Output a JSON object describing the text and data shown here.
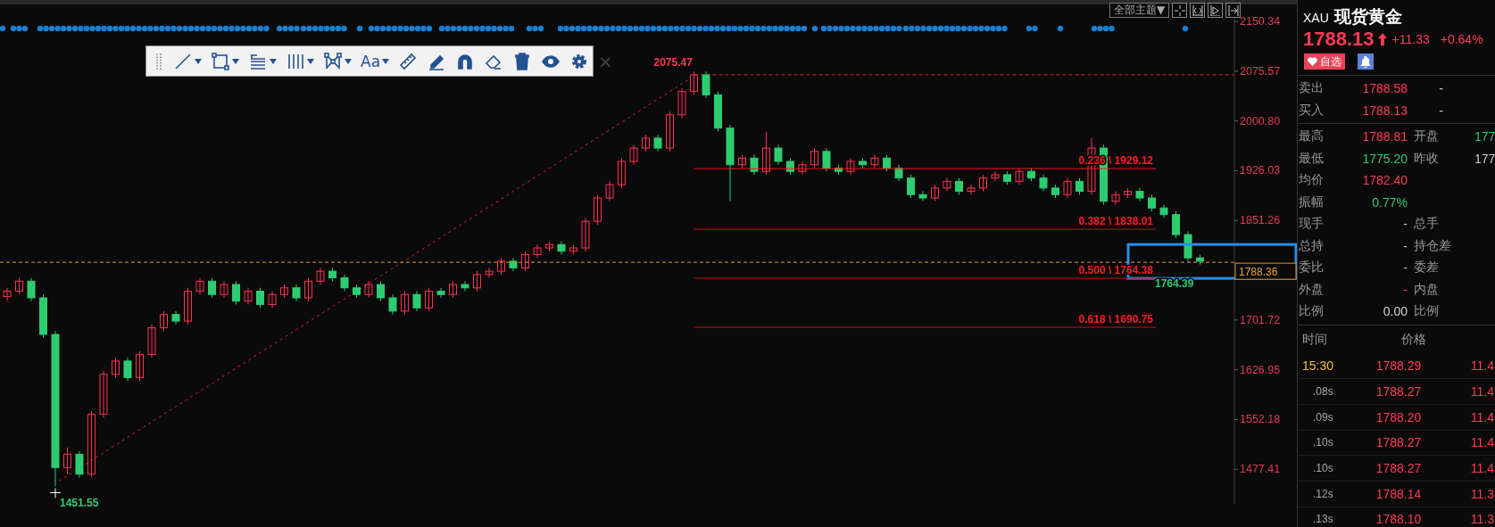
{
  "toolbar": [
    {
      "kind": "grip"
    },
    {
      "kind": "line",
      "dropdown": true
    },
    {
      "kind": "rectangle",
      "dropdown": true
    },
    {
      "kind": "gann",
      "dropdown": true
    },
    {
      "kind": "cycle",
      "dropdown": true
    },
    {
      "kind": "pattern",
      "dropdown": true
    },
    {
      "kind": "text",
      "label": "Aa",
      "dropdown": true
    },
    {
      "kind": "ruler",
      "dropdown": false
    },
    {
      "kind": "pencil",
      "dropdown": false
    },
    {
      "kind": "magnet",
      "dropdown": false
    },
    {
      "kind": "eraser",
      "dropdown": false
    },
    {
      "kind": "trash",
      "dropdown": false
    },
    {
      "kind": "eye",
      "dropdown": false
    },
    {
      "kind": "gear",
      "dropdown": false
    },
    {
      "kind": "close",
      "label": "×",
      "dropdown": false
    }
  ],
  "theme_menu": {
    "label": "全部主题▼"
  },
  "chart": {
    "chart_data": {
      "type": "candlestick",
      "ohlc": [
        [
          1737,
          1750,
          1730,
          1745
        ],
        [
          1745,
          1765,
          1740,
          1760
        ],
        [
          1760,
          1765,
          1730,
          1735
        ],
        [
          1735,
          1740,
          1675,
          1680
        ],
        [
          1680,
          1685,
          1451.55,
          1480
        ],
        [
          1480,
          1510,
          1470,
          1500
        ],
        [
          1500,
          1505,
          1465,
          1470
        ],
        [
          1470,
          1565,
          1465,
          1560
        ],
        [
          1560,
          1625,
          1555,
          1620
        ],
        [
          1620,
          1645,
          1615,
          1640
        ],
        [
          1640,
          1645,
          1610,
          1615
        ],
        [
          1615,
          1655,
          1610,
          1650
        ],
        [
          1650,
          1695,
          1645,
          1690
        ],
        [
          1690,
          1715,
          1685,
          1710
        ],
        [
          1710,
          1715,
          1695,
          1700
        ],
        [
          1700,
          1750,
          1695,
          1745
        ],
        [
          1745,
          1765,
          1740,
          1760
        ],
        [
          1760,
          1765,
          1735,
          1740
        ],
        [
          1740,
          1760,
          1735,
          1755
        ],
        [
          1755,
          1760,
          1725,
          1730
        ],
        [
          1730,
          1750,
          1725,
          1745
        ],
        [
          1745,
          1750,
          1720,
          1725
        ],
        [
          1725,
          1745,
          1720,
          1740
        ],
        [
          1740,
          1755,
          1735,
          1750
        ],
        [
          1750,
          1755,
          1730,
          1735
        ],
        [
          1735,
          1765,
          1730,
          1760
        ],
        [
          1760,
          1780,
          1755,
          1775
        ],
        [
          1775,
          1780,
          1760,
          1765
        ],
        [
          1765,
          1770,
          1745,
          1750
        ],
        [
          1750,
          1755,
          1735,
          1740
        ],
        [
          1740,
          1760,
          1735,
          1755
        ],
        [
          1755,
          1760,
          1730,
          1735
        ],
        [
          1735,
          1740,
          1710,
          1715
        ],
        [
          1715,
          1745,
          1710,
          1740
        ],
        [
          1740,
          1745,
          1715,
          1720
        ],
        [
          1720,
          1750,
          1715,
          1745
        ],
        [
          1745,
          1750,
          1735,
          1740
        ],
        [
          1740,
          1760,
          1735,
          1755
        ],
        [
          1755,
          1760,
          1745,
          1750
        ],
        [
          1750,
          1775,
          1745,
          1770
        ],
        [
          1770,
          1780,
          1765,
          1775
        ],
        [
          1775,
          1795,
          1770,
          1790
        ],
        [
          1790,
          1795,
          1775,
          1780
        ],
        [
          1780,
          1805,
          1775,
          1800
        ],
        [
          1800,
          1815,
          1795,
          1810
        ],
        [
          1810,
          1820,
          1805,
          1815
        ],
        [
          1815,
          1820,
          1800,
          1805
        ],
        [
          1805,
          1815,
          1800,
          1810
        ],
        [
          1810,
          1855,
          1805,
          1850
        ],
        [
          1850,
          1890,
          1845,
          1885
        ],
        [
          1885,
          1910,
          1880,
          1905
        ],
        [
          1905,
          1945,
          1900,
          1940
        ],
        [
          1940,
          1965,
          1935,
          1960
        ],
        [
          1960,
          1980,
          1955,
          1975
        ],
        [
          1975,
          1980,
          1955,
          1960
        ],
        [
          1960,
          2015,
          1955,
          2010
        ],
        [
          2010,
          2050,
          2005,
          2045
        ],
        [
          2045,
          2075.47,
          2040,
          2070
        ],
        [
          2070,
          2075,
          2035,
          2040
        ],
        [
          2040,
          2045,
          1985,
          1990
        ],
        [
          1990,
          1995,
          1880,
          1935
        ],
        [
          1935,
          1950,
          1930,
          1945
        ],
        [
          1945,
          1950,
          1920,
          1925
        ],
        [
          1925,
          1985,
          1920,
          1960
        ],
        [
          1960,
          1965,
          1935,
          1940
        ],
        [
          1940,
          1945,
          1920,
          1925
        ],
        [
          1925,
          1940,
          1920,
          1935
        ],
        [
          1935,
          1960,
          1930,
          1955
        ],
        [
          1955,
          1960,
          1925,
          1930
        ],
        [
          1930,
          1935,
          1920,
          1925
        ],
        [
          1925,
          1945,
          1920,
          1940
        ],
        [
          1940,
          1945,
          1930,
          1935
        ],
        [
          1935,
          1950,
          1930,
          1945
        ],
        [
          1945,
          1950,
          1925,
          1930
        ],
        [
          1930,
          1935,
          1910,
          1915
        ],
        [
          1915,
          1920,
          1885,
          1890
        ],
        [
          1890,
          1895,
          1880,
          1885
        ],
        [
          1885,
          1905,
          1880,
          1900
        ],
        [
          1900,
          1915,
          1895,
          1910
        ],
        [
          1910,
          1915,
          1890,
          1895
        ],
        [
          1895,
          1905,
          1890,
          1900
        ],
        [
          1900,
          1920,
          1895,
          1915
        ],
        [
          1915,
          1925,
          1910,
          1920
        ],
        [
          1920,
          1925,
          1905,
          1910
        ],
        [
          1910,
          1930,
          1905,
          1925
        ],
        [
          1925,
          1930,
          1910,
          1915
        ],
        [
          1915,
          1920,
          1895,
          1900
        ],
        [
          1900,
          1905,
          1885,
          1890
        ],
        [
          1890,
          1915,
          1885,
          1910
        ],
        [
          1910,
          1915,
          1890,
          1895
        ],
        [
          1895,
          1975,
          1890,
          1960
        ],
        [
          1960,
          1965,
          1875,
          1880
        ],
        [
          1880,
          1895,
          1875,
          1890
        ],
        [
          1890,
          1900,
          1885,
          1895
        ],
        [
          1895,
          1900,
          1880,
          1885
        ],
        [
          1885,
          1890,
          1865,
          1870
        ],
        [
          1870,
          1875,
          1855,
          1860
        ],
        [
          1860,
          1865,
          1825,
          1830
        ],
        [
          1830,
          1835,
          1790,
          1795
        ],
        [
          1795,
          1800,
          1785,
          1790
        ]
      ],
      "ylim": [
        1425,
        2171.8
      ],
      "yticks": [
        {
          "value": 2150.34,
          "label": "2150.34"
        },
        {
          "value": 2075.57,
          "label": "2075.57"
        },
        {
          "value": 2000.8,
          "label": "2000.80"
        },
        {
          "value": 1926.03,
          "label": "1926.03"
        },
        {
          "value": 1851.26,
          "label": "1851.26"
        },
        {
          "value": 1701.72,
          "label": "1701.72"
        },
        {
          "value": 1626.95,
          "label": "1626.95"
        },
        {
          "value": 1552.18,
          "label": "1552.18"
        },
        {
          "value": 1477.41,
          "label": "1477.41"
        }
      ],
      "ref_lines": [
        {
          "axis": "y",
          "value": 1929.12,
          "label": "0.236 \\ 1929.12",
          "color": "#ff1020"
        },
        {
          "axis": "y",
          "value": 1838.01,
          "label": "0.382 \\ 1838.01",
          "color": "#c01018"
        },
        {
          "axis": "y",
          "value": 1764.38,
          "label": "0.500 \\ 1764.38",
          "color": "#c01018"
        },
        {
          "axis": "y",
          "value": 1690.75,
          "label": "0.618 \\ 1690.75",
          "color": "#c01018"
        },
        {
          "axis": "y",
          "value": 1788.36,
          "label": "1788.36",
          "color": "#e0902a"
        }
      ],
      "annotations": [
        "2075.47",
        "1451.55",
        "1764.39"
      ]
    }
  },
  "quote": {
    "symbol": "XAU",
    "name": "现货黄金",
    "price": "1788.13",
    "change": "+11.33",
    "change_pct": "+0.64%",
    "watch_button": "自选"
  },
  "book": [
    {
      "label": "卖出",
      "value": "1788.58",
      "extra": "-"
    },
    {
      "label": "买入",
      "value": "1788.13",
      "extra": "-"
    }
  ],
  "stats": [
    {
      "label": "最高",
      "value": "1788.81",
      "color": "#ff3a55",
      "right": {
        "label": "开盘",
        "value": "177",
        "color": "#2ecc71"
      }
    },
    {
      "label": "最低",
      "value": "1775.20",
      "color": "#2ecc71",
      "right": {
        "label": "昨收",
        "value": "177",
        "color": "#d0d0d0"
      }
    },
    {
      "label": "均价",
      "value": "1782.40",
      "color": "#ff3a55"
    },
    {
      "label": "振幅",
      "value": "0.77%",
      "color": "#2ecc71"
    },
    {
      "label": "现手",
      "value": "-",
      "color": "#bbbbbb",
      "right": {
        "label": "总手"
      }
    },
    {
      "label": "总持",
      "value": "-",
      "color": "#bbbbbb",
      "right": {
        "label": "持仓差"
      }
    },
    {
      "label": "委比",
      "value": "-",
      "color": "#bbbbbb",
      "right": {
        "label": "委差"
      }
    },
    {
      "label": "外盘",
      "value": "-",
      "color": "#ff3a55",
      "right": {
        "label": "内盘"
      }
    },
    {
      "label": "比例",
      "value": "0.00",
      "color": "#d0d0d0",
      "right": {
        "label": "比例"
      }
    }
  ],
  "ticks": {
    "columns": [
      "时间",
      "价格"
    ],
    "rows": [
      {
        "kind": "minute",
        "time": "15:30",
        "price": "1788.29",
        "volume": "11.4"
      },
      {
        "kind": "second",
        "time": ".08s",
        "price": "1788.27",
        "volume": "11.4"
      },
      {
        "kind": "second",
        "time": ".09s",
        "price": "1788.20",
        "volume": "11.4"
      },
      {
        "kind": "second",
        "time": ".10s",
        "price": "1788.27",
        "volume": "11.4"
      },
      {
        "kind": "second",
        "time": ".10s",
        "price": "1788.27",
        "volume": "11.4"
      },
      {
        "kind": "second",
        "time": ".12s",
        "price": "1788.14",
        "volume": "11.3"
      },
      {
        "kind": "second",
        "time": ".13s",
        "price": "1788.10",
        "volume": "11.3"
      }
    ]
  }
}
